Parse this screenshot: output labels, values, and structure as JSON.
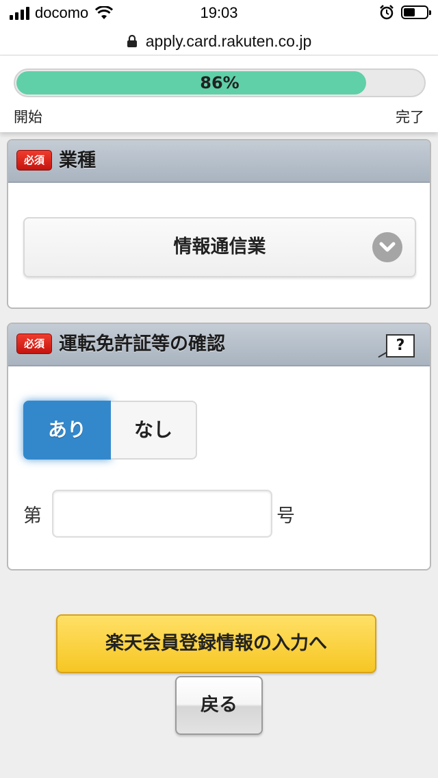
{
  "status_bar": {
    "carrier": "docomo",
    "time": "19:03",
    "battery_level": 0.5
  },
  "browser": {
    "url": "apply.card.rakuten.co.jp"
  },
  "progress": {
    "percent_label": "86%",
    "value": 0.86,
    "start_label": "開始",
    "end_label": "完了",
    "fill_color": "#5fd0a8"
  },
  "industry_section": {
    "required_badge": "必須",
    "title": "業種",
    "selected_value": "情報通信業"
  },
  "license_section": {
    "required_badge": "必須",
    "title": "運転免許証等の確認",
    "help_label": "?",
    "option_yes": "あり",
    "option_no": "なし",
    "selected_option": "あり",
    "number_prefix": "第",
    "number_value": "",
    "number_suffix": "号"
  },
  "actions": {
    "next_label": "楽天会員登録情報の入力へ",
    "back_label": "戻る"
  },
  "colors": {
    "accent_blue": "#3388cc",
    "next_button": "#f6c623",
    "required_red": "#d41f15"
  }
}
